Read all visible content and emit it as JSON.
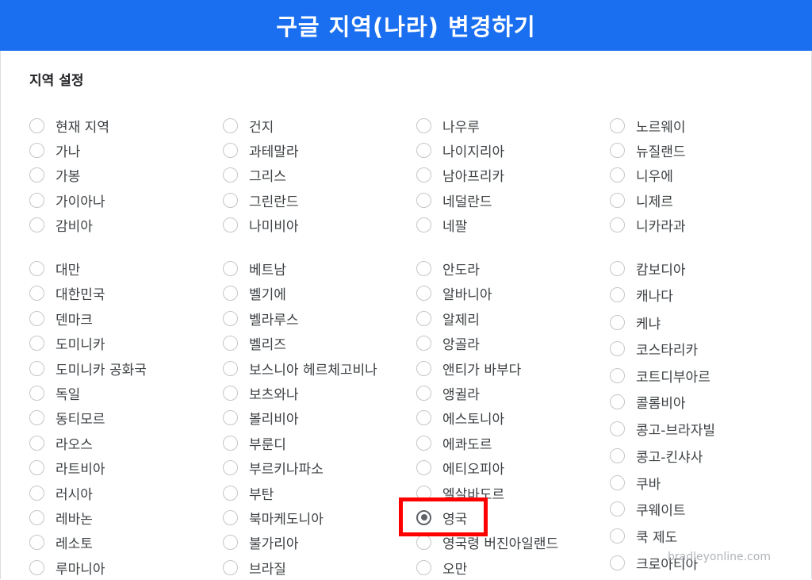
{
  "banner": {
    "title": "구글 지역(나라) 변경하기"
  },
  "section": {
    "title": "지역 설정"
  },
  "columns": [
    [
      {
        "label": "현재 지역"
      },
      {
        "label": "가나"
      },
      {
        "label": "가봉"
      },
      {
        "label": "가이아나"
      },
      {
        "label": "감비아"
      },
      {
        "label": "대만"
      },
      {
        "label": "대한민국"
      },
      {
        "label": "덴마크"
      },
      {
        "label": "도미니카"
      },
      {
        "label": "도미니카 공화국"
      },
      {
        "label": "독일"
      },
      {
        "label": "동티모르"
      },
      {
        "label": "라오스"
      },
      {
        "label": "라트비아"
      },
      {
        "label": "러시아"
      },
      {
        "label": "레바논"
      },
      {
        "label": "레소토"
      },
      {
        "label": "루마니아"
      }
    ],
    [
      {
        "label": "건지"
      },
      {
        "label": "과테말라"
      },
      {
        "label": "그리스"
      },
      {
        "label": "그린란드"
      },
      {
        "label": "나미비아"
      },
      {
        "label": "베트남"
      },
      {
        "label": "벨기에"
      },
      {
        "label": "벨라루스"
      },
      {
        "label": "벨리즈"
      },
      {
        "label": "보스니아 헤르체고비나"
      },
      {
        "label": "보츠와나"
      },
      {
        "label": "볼리비아"
      },
      {
        "label": "부룬디"
      },
      {
        "label": "부르키나파소"
      },
      {
        "label": "부탄"
      },
      {
        "label": "북마케도니아"
      },
      {
        "label": "불가리아"
      },
      {
        "label": "브라질"
      }
    ],
    [
      {
        "label": "나우루"
      },
      {
        "label": "나이지리아"
      },
      {
        "label": "남아프리카"
      },
      {
        "label": "네덜란드"
      },
      {
        "label": "네팔"
      },
      {
        "label": "안도라"
      },
      {
        "label": "알바니아"
      },
      {
        "label": "알제리"
      },
      {
        "label": "앙골라"
      },
      {
        "label": "앤티가 바부다"
      },
      {
        "label": "앵귈라"
      },
      {
        "label": "에스토니아"
      },
      {
        "label": "에콰도르"
      },
      {
        "label": "에티오피아"
      },
      {
        "label": "엘살바도르"
      },
      {
        "label": "영국",
        "checked": true
      },
      {
        "label": "영국령 버진아일랜드"
      },
      {
        "label": "오만"
      }
    ],
    [
      {
        "label": "노르웨이"
      },
      {
        "label": "뉴질랜드"
      },
      {
        "label": "니우에"
      },
      {
        "label": "니제르"
      },
      {
        "label": "니카라과"
      },
      {
        "label": "캄보디아"
      },
      {
        "label": "캐나다"
      },
      {
        "label": "케냐"
      },
      {
        "label": "코스타리카"
      },
      {
        "label": "코트디부아르"
      },
      {
        "label": "콜롬비아"
      },
      {
        "label": "콩고-브라자빌"
      },
      {
        "label": "콩고-킨샤사"
      },
      {
        "label": "쿠바"
      },
      {
        "label": "쿠웨이트"
      },
      {
        "label": "쿡 제도"
      },
      {
        "label": "크로아티아"
      }
    ]
  ],
  "watermark": {
    "text": "bradleyonline.com"
  },
  "colors": {
    "banner": "#1a6ff0",
    "highlight": "#ff0000"
  }
}
